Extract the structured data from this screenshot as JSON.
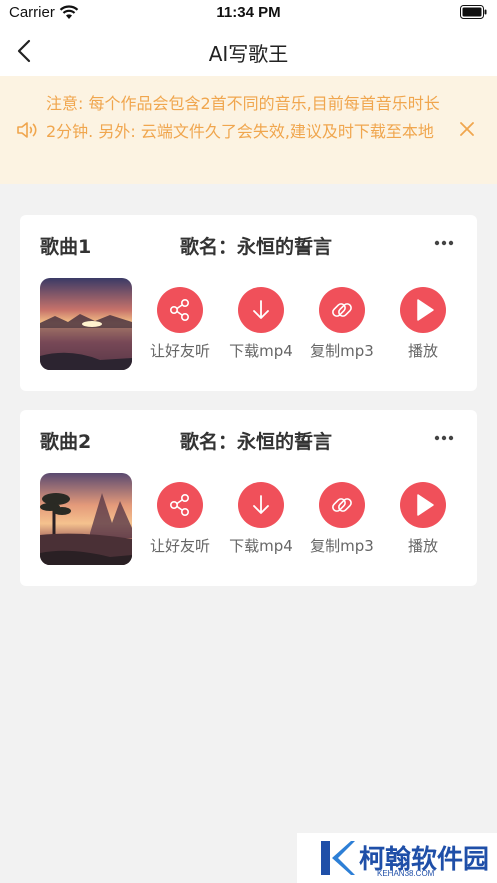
{
  "status_bar": {
    "carrier": "Carrier",
    "time": "11:34 PM"
  },
  "nav": {
    "title": "AI写歌王"
  },
  "notice": {
    "text": "注意: 每个作品会包含2首不同的音乐,目前每首音乐时长2分钟. 另外: 云端文件久了会失效,建议及时下载至本地",
    "color": "#f0a64e",
    "background": "#fcf3e2"
  },
  "songs": [
    {
      "index_label": "歌曲1",
      "name": "歌名：永恒的誓言"
    },
    {
      "index_label": "歌曲2",
      "name": "歌名：永恒的誓言"
    }
  ],
  "actions": {
    "share": "让好友听",
    "download": "下载mp4",
    "copy": "复制mp3",
    "play": "播放"
  },
  "accent_color": "#f0505a",
  "watermark": {
    "name": "柯翰软件园",
    "url": "KEHAN38.COM"
  }
}
